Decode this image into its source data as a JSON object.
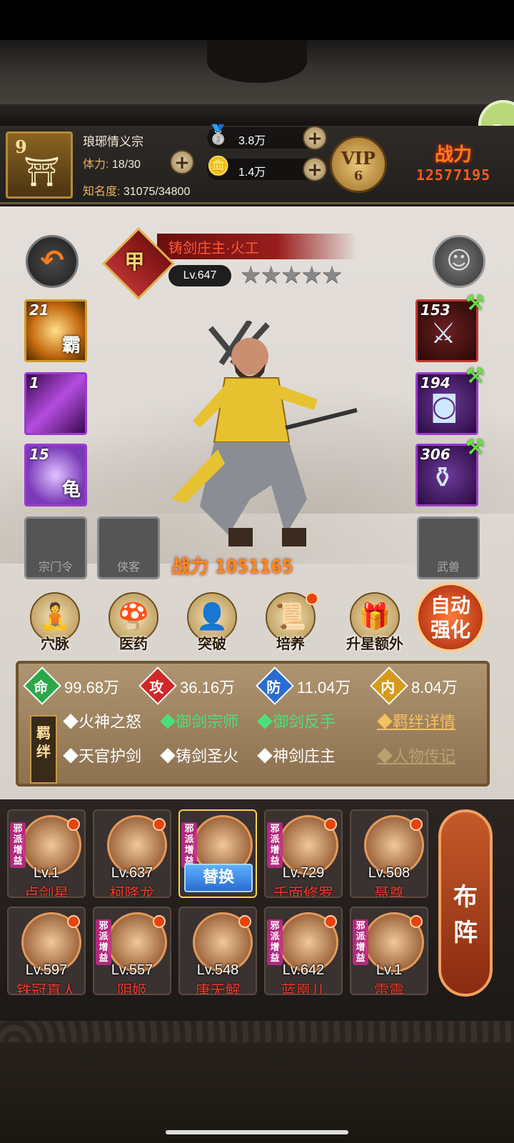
{
  "topbar": {
    "level": "9",
    "sect_name": "琅琊情义宗",
    "stamina_label": "体力:",
    "stamina_value": "18/30",
    "fame_label": "知名度:",
    "fame_value": "31075/34800",
    "silver": "3.8万",
    "gold": "1.4万",
    "vip_label": "VIP",
    "vip_level": "6",
    "power_label": "战力",
    "power_value": "12577195"
  },
  "hero": {
    "name": "铸剑庄主·火工",
    "rank_char": "甲",
    "level": "Lv.647",
    "stars": "★★★★★",
    "power_label": "战力",
    "power_value": "1051165",
    "skills": [
      {
        "count": "21",
        "char": "霸"
      },
      {
        "count": "1",
        "char": ""
      },
      {
        "count": "15",
        "char": "龟"
      }
    ],
    "empty_slots": [
      "宗门令",
      "侠客",
      "武兽"
    ],
    "equipment": [
      {
        "count": "153"
      },
      {
        "count": "194"
      },
      {
        "count": "306"
      }
    ]
  },
  "functions": [
    "穴脉",
    "医药",
    "突破",
    "培养",
    "升星额外"
  ],
  "auto_button": "自动强化",
  "attributes": [
    {
      "icon": "命",
      "value": "99.68万",
      "color": "#2aa84a"
    },
    {
      "icon": "攻",
      "value": "36.16万",
      "color": "#d02828"
    },
    {
      "icon": "防",
      "value": "11.04万",
      "color": "#2a6cd0"
    },
    {
      "icon": "内",
      "value": "8.04万",
      "color": "#d69a1a"
    }
  ],
  "bonds": {
    "tag": "羁绊",
    "row1": [
      "◆火神之怒",
      "◆御剑宗师",
      "◆御剑反手"
    ],
    "row2": [
      "◆天官护剑",
      "◆铸剑圣火",
      "◆神剑庄主"
    ],
    "detail_link": "◆羁绊详情",
    "bio_link": "◆人物传记"
  },
  "roster": [
    {
      "level": "Lv.1",
      "name": "卢剑星",
      "tag": "邪派增益"
    },
    {
      "level": "Lv.637",
      "name": "柯降龙",
      "tag": ""
    },
    {
      "level": "",
      "name": "",
      "tag": "邪派增益",
      "swap": "替换"
    },
    {
      "level": "Lv.729",
      "name": "千面修罗",
      "tag": "邪派增益"
    },
    {
      "level": "Lv.508",
      "name": "聂尊",
      "tag": ""
    },
    {
      "level": "Lv.597",
      "name": "铁冠真人",
      "tag": ""
    },
    {
      "level": "Lv.557",
      "name": "阴姬",
      "tag": "邪派增益"
    },
    {
      "level": "Lv.548",
      "name": "唐无解",
      "tag": ""
    },
    {
      "level": "Lv.642",
      "name": "蓝凰儿",
      "tag": "邪派增益"
    },
    {
      "level": "Lv.1",
      "name": "雷震",
      "tag": "邪派增益"
    }
  ],
  "formation_button": "布阵"
}
